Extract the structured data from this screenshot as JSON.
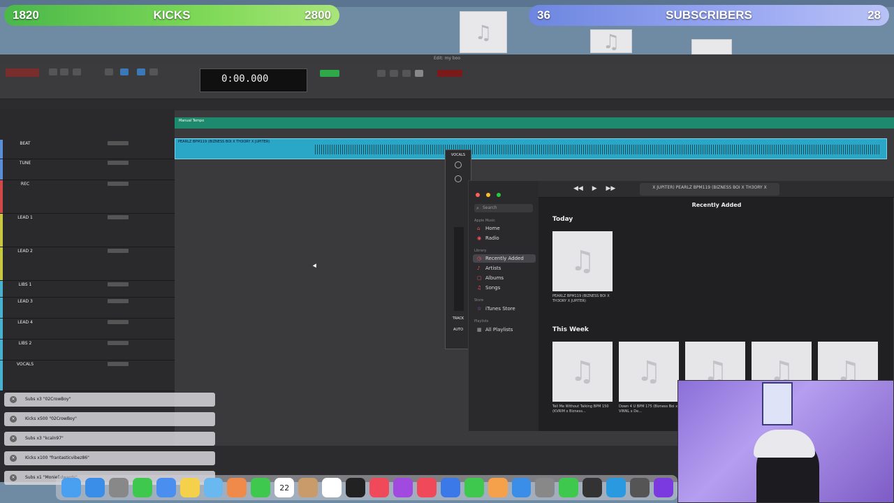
{
  "overlay": {
    "kicks": {
      "left": "1820",
      "title": "KICKS",
      "right": "2800"
    },
    "subs": {
      "left": "36",
      "title": "SUBSCRIBERS",
      "right": "28"
    }
  },
  "protools": {
    "window_title": "Edit: my boo",
    "counter": "0:00.000",
    "ruler_tempo": "Manual Tempo",
    "clip_name": "PEARLZ BPM119 (BIZNESS BOI X TH3ORY X JUPITER)",
    "tracks": [
      {
        "name": "BEAT",
        "color": "#5a8fd8"
      },
      {
        "name": "TUNE",
        "color": "#5a8fd8"
      },
      {
        "name": "REC",
        "color": "#d04848"
      },
      {
        "name": "LEAD 1",
        "color": "#c8c840"
      },
      {
        "name": "LEAD 2",
        "color": "#c8c840"
      },
      {
        "name": "LIBS 1",
        "color": "#48b0d0"
      },
      {
        "name": "LEAD 3",
        "color": "#48b0d0"
      },
      {
        "name": "LEAD 4",
        "color": "#48b0d0"
      },
      {
        "name": "LIBS 2",
        "color": "#48b0d0"
      },
      {
        "name": "VOCALS",
        "color": "#48b0d0"
      }
    ],
    "mixer": {
      "label": "VOCALS",
      "track": "TRACK",
      "auto": "AUTO"
    }
  },
  "music": {
    "search_placeholder": "Search",
    "apple_music_label": "Apple Music",
    "library_label": "Library",
    "store_label": "Store",
    "playlists_label": "Playlists",
    "sidebar": {
      "home": "Home",
      "radio": "Radio",
      "recently_added": "Recently Added",
      "artists": "Artists",
      "albums": "Albums",
      "songs": "Songs",
      "itunes_store": "iTunes Store",
      "all_playlists": "All Playlists"
    },
    "now_playing": "X JUPITER)  PEARLZ BPM119 (BIZNESS BOI X TH3ORY X",
    "page_title": "Recently Added",
    "today_label": "Today",
    "this_week_label": "This Week",
    "today_albums": [
      {
        "caption": "PEARLZ BPM119 (BIZNESS BOI X TH3ORY X JUPITER)"
      }
    ],
    "week_albums": [
      {
        "caption": "Tell Me Without Talking BPM 150 (KVRIM x Bizness..."
      },
      {
        "caption": "Down 4 U BPM 175 (Bizness Boi x VINNL x De..."
      },
      {
        "caption": ""
      },
      {
        "caption": ""
      },
      {
        "caption": ""
      }
    ]
  },
  "notifications": [
    "Subs x3 \"02CrowBoy\"",
    "Kicks x500 \"02CrowBoy\"",
    "Subs x3 \"kcaln97\"",
    "Kicks x100 \"frantasticvibez86\"",
    "Subs x1 \"MonieEdwards\""
  ],
  "dock": {
    "calendar_day": "22",
    "icons": [
      "finder-icon",
      "safari-icon",
      "launchpad-icon",
      "messages-icon",
      "mail-icon",
      "notes-icon",
      "preview-icon",
      "photos-icon",
      "facetime-icon",
      "calendar-icon",
      "contacts-icon",
      "reminders-icon",
      "tv-icon",
      "music-icon",
      "podcasts-icon",
      "news-icon",
      "keynote-icon",
      "numbers-icon",
      "pages-icon",
      "appstore-icon",
      "settings-icon",
      "logic-icon",
      "ilok-icon",
      "circle-app-icon",
      "protools-icon",
      "ableton-icon"
    ]
  }
}
